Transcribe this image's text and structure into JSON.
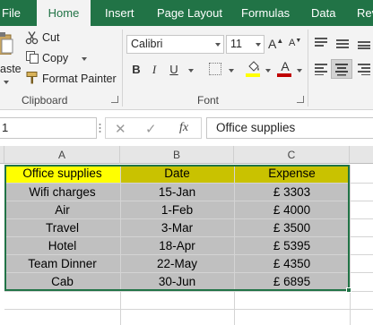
{
  "ribbon_tabs": [
    {
      "label": "File"
    },
    {
      "label": "Home"
    },
    {
      "label": "Insert"
    },
    {
      "label": "Page Layout"
    },
    {
      "label": "Formulas"
    },
    {
      "label": "Data"
    },
    {
      "label": "Rev"
    }
  ],
  "active_tab": "Home",
  "clipboard": {
    "paste_label": "aste",
    "cut_label": "Cut",
    "copy_label": "Copy",
    "format_painter_label": "Format Painter",
    "group_label": "Clipboard"
  },
  "font": {
    "font_name": "Calibri",
    "font_size": "11",
    "bold_label": "B",
    "italic_label": "I",
    "underline_label": "U",
    "group_label": "Font",
    "fill_color": "#ffff00",
    "font_color": "#c00000"
  },
  "formula_bar": {
    "name_box": "1",
    "cancel_glyph": "✕",
    "enter_glyph": "✓",
    "fx_label": "fx",
    "formula": "Office supplies"
  },
  "columns": [
    "A",
    "B",
    "C"
  ],
  "table": {
    "headers": [
      "Office supplies",
      "Date",
      "Expense"
    ],
    "rows": [
      [
        "Wifi charges",
        "15-Jan",
        "£ 3303"
      ],
      [
        "Air",
        "1-Feb",
        "£ 4000"
      ],
      [
        "Travel",
        "3-Mar",
        "£ 3500"
      ],
      [
        "Hotel",
        "18-Apr",
        "£ 5395"
      ],
      [
        "Team Dinner",
        "22-May",
        "£ 4350"
      ],
      [
        "Cab",
        "30-Jun",
        "£ 6895"
      ]
    ]
  },
  "colors": {
    "accent": "#217346",
    "header_a_fill": "#ffff00",
    "header_fill": "#c9c200",
    "selected_fill": "#c0c0c0"
  }
}
